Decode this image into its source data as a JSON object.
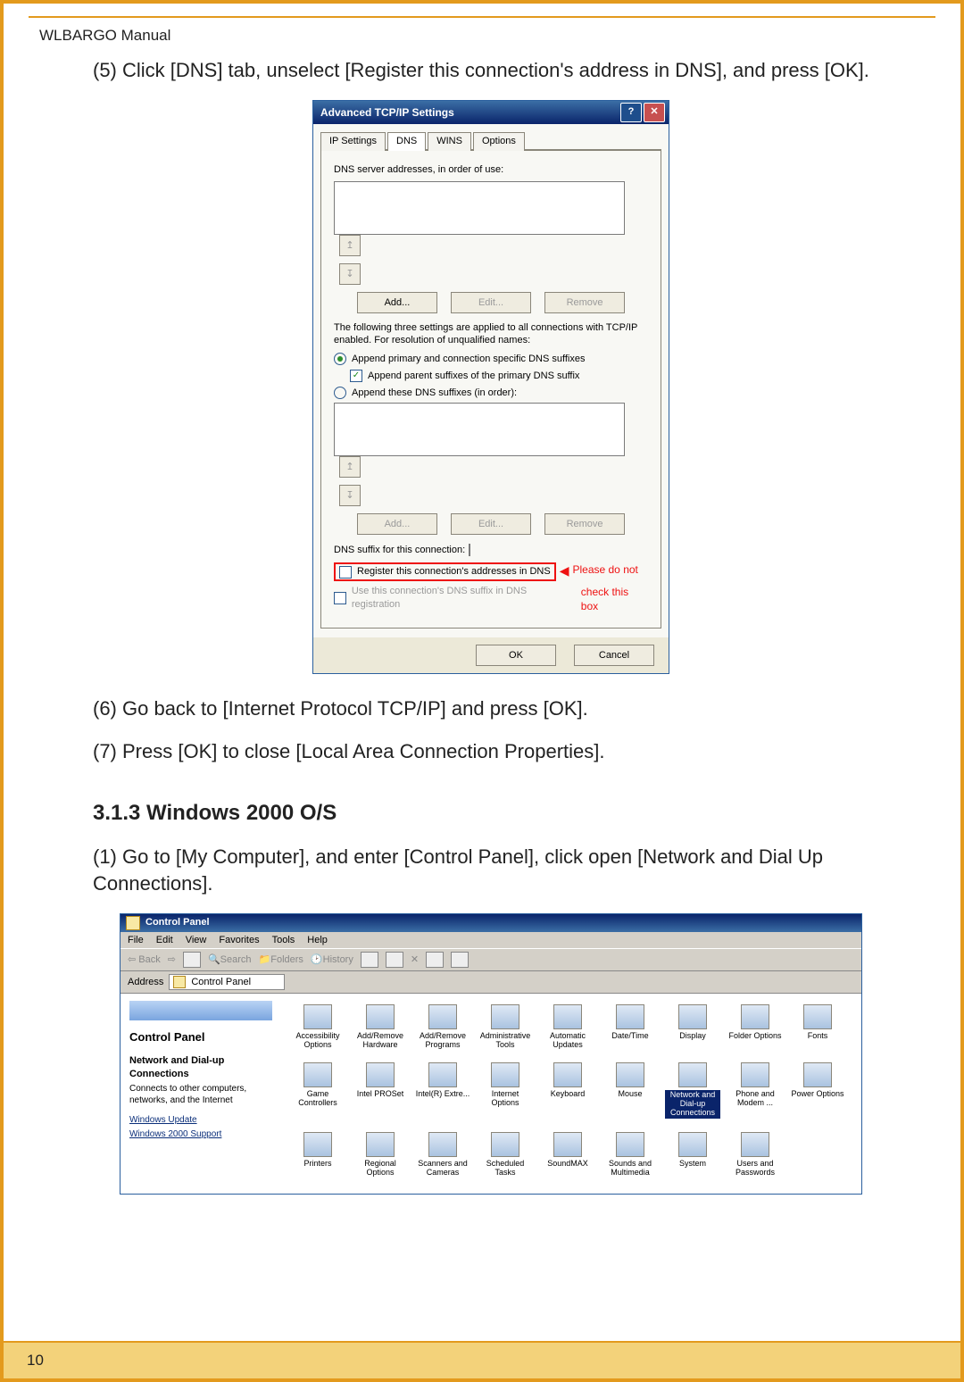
{
  "doc": {
    "header": "WLBARGO Manual",
    "page_number": "10"
  },
  "steps": {
    "s5": "(5) Click [DNS] tab, unselect [Register this connection's address in DNS], and press [OK].",
    "s6": "(6) Go back to [Internet Protocol TCP/IP] and press [OK].",
    "s7": "(7) Press [OK] to close [Local Area Connection Properties].",
    "section_heading": "3.1.3 Windows 2000 O/S",
    "s1b": "(1) Go to [My Computer], and enter [Control Panel], click open [Network and Dial Up Connections]."
  },
  "xp": {
    "title": "Advanced TCP/IP Settings",
    "help_glyph": "?",
    "close_glyph": "✕",
    "tabs": {
      "ip": "IP Settings",
      "dns": "DNS",
      "wins": "WINS",
      "options": "Options"
    },
    "dns_addr_label": "DNS server addresses, in order of use:",
    "up_glyph": "↥",
    "down_glyph": "↧",
    "add_btn": "Add...",
    "edit_btn": "Edit...",
    "remove_btn": "Remove",
    "three_settings": "The following three settings are applied to all connections with TCP/IP enabled. For resolution of unqualified names:",
    "radio1": "Append primary and connection specific DNS suffixes",
    "check1": "Append parent suffixes of the primary DNS suffix",
    "radio2": "Append these DNS suffixes (in order):",
    "suffix_label": "DNS suffix for this connection:",
    "check_register": "Register this connection's addresses in DNS",
    "check_usedns": "Use this connection's DNS suffix in DNS registration",
    "ok": "OK",
    "cancel": "Cancel",
    "annot_line1": "Please do not",
    "annot_line2": "check this box",
    "annot_arrow": "◀"
  },
  "cp": {
    "title": "Control Panel",
    "menus": [
      "File",
      "Edit",
      "View",
      "Favorites",
      "Tools",
      "Help"
    ],
    "tool_back": "Back",
    "tool_search": "Search",
    "tool_folders": "Folders",
    "tool_history": "History",
    "addr_label": "Address",
    "addr_value": "Control Panel",
    "side_title": "Control Panel",
    "side_item_title": "Network and Dial-up Connections",
    "side_item_desc": "Connects to other computers, networks, and the Internet",
    "side_link1": "Windows Update",
    "side_link2": "Windows 2000 Support",
    "items_row1": [
      "Accessibility Options",
      "Add/Remove Hardware",
      "Add/Remove Programs",
      "Administrative Tools",
      "Automatic Updates",
      "Date/Time",
      "Display",
      "Folder Options",
      "Fonts",
      "Game Controllers"
    ],
    "items_row2": [
      "Intel PROSet",
      "Intel(R) Extre...",
      "Internet Options",
      "Keyboard",
      "Mouse",
      "Network and Dial-up Connections",
      "Phone and Modem ...",
      "Power Options",
      "Printers",
      "Regional Options"
    ],
    "items_row3": [
      "Scanners and Cameras",
      "Scheduled Tasks",
      "SoundMAX",
      "Sounds and Multimedia",
      "System",
      "Users and Passwords"
    ],
    "highlight_index_row2": 5
  }
}
